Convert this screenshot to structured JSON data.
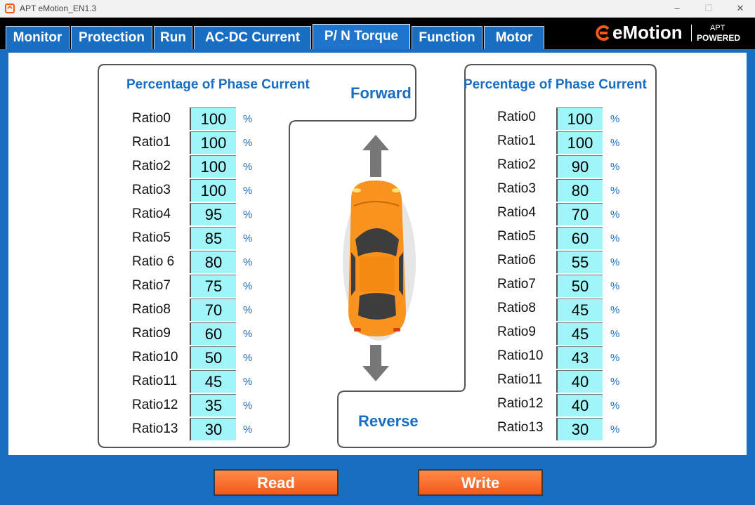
{
  "window": {
    "title": "APT eMotion_EN1.3",
    "minimize": "–",
    "maximize": "☐",
    "close": "✕"
  },
  "tabs": [
    {
      "label": "Monitor",
      "active": false
    },
    {
      "label": "Protection",
      "active": false
    },
    {
      "label": "Run",
      "active": false
    },
    {
      "label": "AC-DC Current",
      "active": false
    },
    {
      "label": "P/ N Torque",
      "active": true
    },
    {
      "label": "Function",
      "active": false
    },
    {
      "label": "Motor",
      "active": false
    }
  ],
  "logo": {
    "name": "eMotion",
    "sub1": "APT",
    "sub2": "POWERED"
  },
  "forward": {
    "heading": "Percentage of Phase Current",
    "direction_label": "Forward",
    "rows": [
      {
        "label": "Ratio0",
        "value": "100",
        "unit": "%"
      },
      {
        "label": "Ratio1",
        "value": "100",
        "unit": "%"
      },
      {
        "label": "Ratio2",
        "value": "100",
        "unit": "%"
      },
      {
        "label": "Ratio3",
        "value": "100",
        "unit": "%"
      },
      {
        "label": "Ratio4",
        "value": "95",
        "unit": "%"
      },
      {
        "label": "Ratio5",
        "value": "85",
        "unit": "%"
      },
      {
        "label": "Ratio 6",
        "value": "80",
        "unit": "%"
      },
      {
        "label": "Ratio7",
        "value": "75",
        "unit": "%"
      },
      {
        "label": "Ratio8",
        "value": "70",
        "unit": "%"
      },
      {
        "label": "Ratio9",
        "value": "60",
        "unit": "%"
      },
      {
        "label": "Ratio10",
        "value": "50",
        "unit": "%"
      },
      {
        "label": "Ratio11",
        "value": "45",
        "unit": "%"
      },
      {
        "label": "Ratio12",
        "value": "35",
        "unit": "%"
      },
      {
        "label": "Ratio13",
        "value": "30",
        "unit": "%"
      }
    ]
  },
  "reverse": {
    "heading": "Percentage of Phase Current",
    "direction_label": "Reverse",
    "rows": [
      {
        "label": "Ratio0",
        "value": "100",
        "unit": "%"
      },
      {
        "label": "Ratio1",
        "value": "100",
        "unit": "%"
      },
      {
        "label": "Ratio2",
        "value": "90",
        "unit": "%"
      },
      {
        "label": "Ratio3",
        "value": "80",
        "unit": "%"
      },
      {
        "label": "Ratio4",
        "value": "70",
        "unit": "%"
      },
      {
        "label": "Ratio5",
        "value": "60",
        "unit": "%"
      },
      {
        "label": "Ratio6",
        "value": "55",
        "unit": "%"
      },
      {
        "label": "Ratio7",
        "value": "50",
        "unit": "%"
      },
      {
        "label": "Ratio8",
        "value": "45",
        "unit": "%"
      },
      {
        "label": "Ratio9",
        "value": "45",
        "unit": "%"
      },
      {
        "label": "Ratio10",
        "value": "43",
        "unit": "%"
      },
      {
        "label": "Ratio11",
        "value": "40",
        "unit": "%"
      },
      {
        "label": "Ratio12",
        "value": "40",
        "unit": "%"
      },
      {
        "label": "Ratio13",
        "value": "30",
        "unit": "%"
      }
    ]
  },
  "buttons": {
    "read": "Read",
    "write": "Write"
  },
  "colors": {
    "accent": "#1a6ec2",
    "value_bg": "#9ff5f8",
    "button": "#f25a17",
    "car": "#f7931e"
  },
  "icons": {
    "app": "app-logo-icon",
    "arrow_up": "arrow-up-icon",
    "arrow_down": "arrow-down-icon",
    "car": "car-icon"
  }
}
